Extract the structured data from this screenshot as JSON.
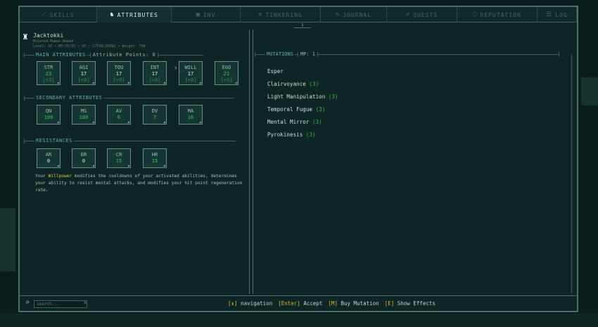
{
  "tabs": [
    {
      "label": "SKILLS",
      "icon": "skills-icon",
      "glyph": "⟋",
      "active": false
    },
    {
      "label": "ATTRIBUTES",
      "icon": "character-icon",
      "glyph": "♞",
      "active": true
    },
    {
      "label": "INV",
      "icon": "inventory-icon",
      "glyph": "▣",
      "active": false
    },
    {
      "label": "TINKERING",
      "icon": "tinkering-icon",
      "glyph": "⚒",
      "active": false
    },
    {
      "label": "JOURNAL",
      "icon": "journal-icon",
      "glyph": "✎",
      "active": false
    },
    {
      "label": "QUESTS",
      "icon": "quests-icon",
      "glyph": "✐",
      "active": false
    },
    {
      "label": "REPUTATION",
      "icon": "reputation-icon",
      "glyph": "☖",
      "active": false
    },
    {
      "label": "LOG",
      "icon": "log-icon",
      "glyph": "☰",
      "active": false
    }
  ],
  "character": {
    "name": "Jacktokki",
    "subtitle": "Mutated Human Nomad",
    "stats_line": "Level: 16 • HP:35/35 • XP : 17598/20882 • Weight: 78#"
  },
  "main_attributes": {
    "heading": "MAIN ATTRIBUTES",
    "points_label": "Attribute Points: 0",
    "items": [
      {
        "label": "STR",
        "value": "23",
        "bonus": "[+3]"
      },
      {
        "label": "AGI",
        "value": "17",
        "bonus": "[+0]"
      },
      {
        "label": "TOU",
        "value": "17",
        "bonus": "[+0]"
      },
      {
        "label": "INT",
        "value": "17",
        "bonus": "[+0]"
      },
      {
        "label": "WILL",
        "value": "17",
        "bonus": "[+0]"
      },
      {
        "label": "EGO",
        "value": "21",
        "bonus": "[+3]"
      }
    ],
    "selected_marker": "›"
  },
  "secondary_attributes": {
    "heading": "SECONDARY ATTRIBUTES",
    "items": [
      {
        "label": "QN",
        "value": "100"
      },
      {
        "label": "MS",
        "value": "100"
      },
      {
        "label": "AV",
        "value": "6"
      },
      {
        "label": "DV",
        "value": "7"
      },
      {
        "label": "MA",
        "value": "16"
      }
    ]
  },
  "resistances": {
    "heading": "RESISTANCES",
    "items": [
      {
        "label": "AR",
        "value": "0"
      },
      {
        "label": "ER",
        "value": "0"
      },
      {
        "label": "CR",
        "value": "15"
      },
      {
        "label": "HR",
        "value": "15"
      }
    ]
  },
  "description": {
    "prefix": "Your ",
    "highlight": "Willpower",
    "rest": " modifies the cooldowns of your activated abilities, determines your ability to resist mental attacks, and modifies your hit point regeneration rate."
  },
  "mutations": {
    "heading": "MUTATIONS",
    "mp_label": "MP: 1",
    "items": [
      {
        "name": "Esper",
        "level": ""
      },
      {
        "name": "Clairvoyance",
        "level": "(3)"
      },
      {
        "name": "Light Manipulation",
        "level": "(3)"
      },
      {
        "name": "Temporal Fugue",
        "level": "(3)"
      },
      {
        "name": "Mental Mirror",
        "level": "(3)"
      },
      {
        "name": "Pyrokinesis",
        "level": "(3)"
      }
    ]
  },
  "bottom": {
    "search_placeholder": "search...",
    "hints": [
      {
        "key": "[⇞]",
        "text": "navigation"
      },
      {
        "key": "[Enter]",
        "text": "Accept"
      },
      {
        "key": "[M]",
        "text": "Buy Mutation"
      },
      {
        "key": "[E]",
        "text": "Show Effects"
      }
    ]
  },
  "colors": {
    "accent": "#67b0a7",
    "bonus_green": "#47c25b",
    "highlight_yellow": "#d8c94a",
    "key_gold": "#d9b43c"
  }
}
